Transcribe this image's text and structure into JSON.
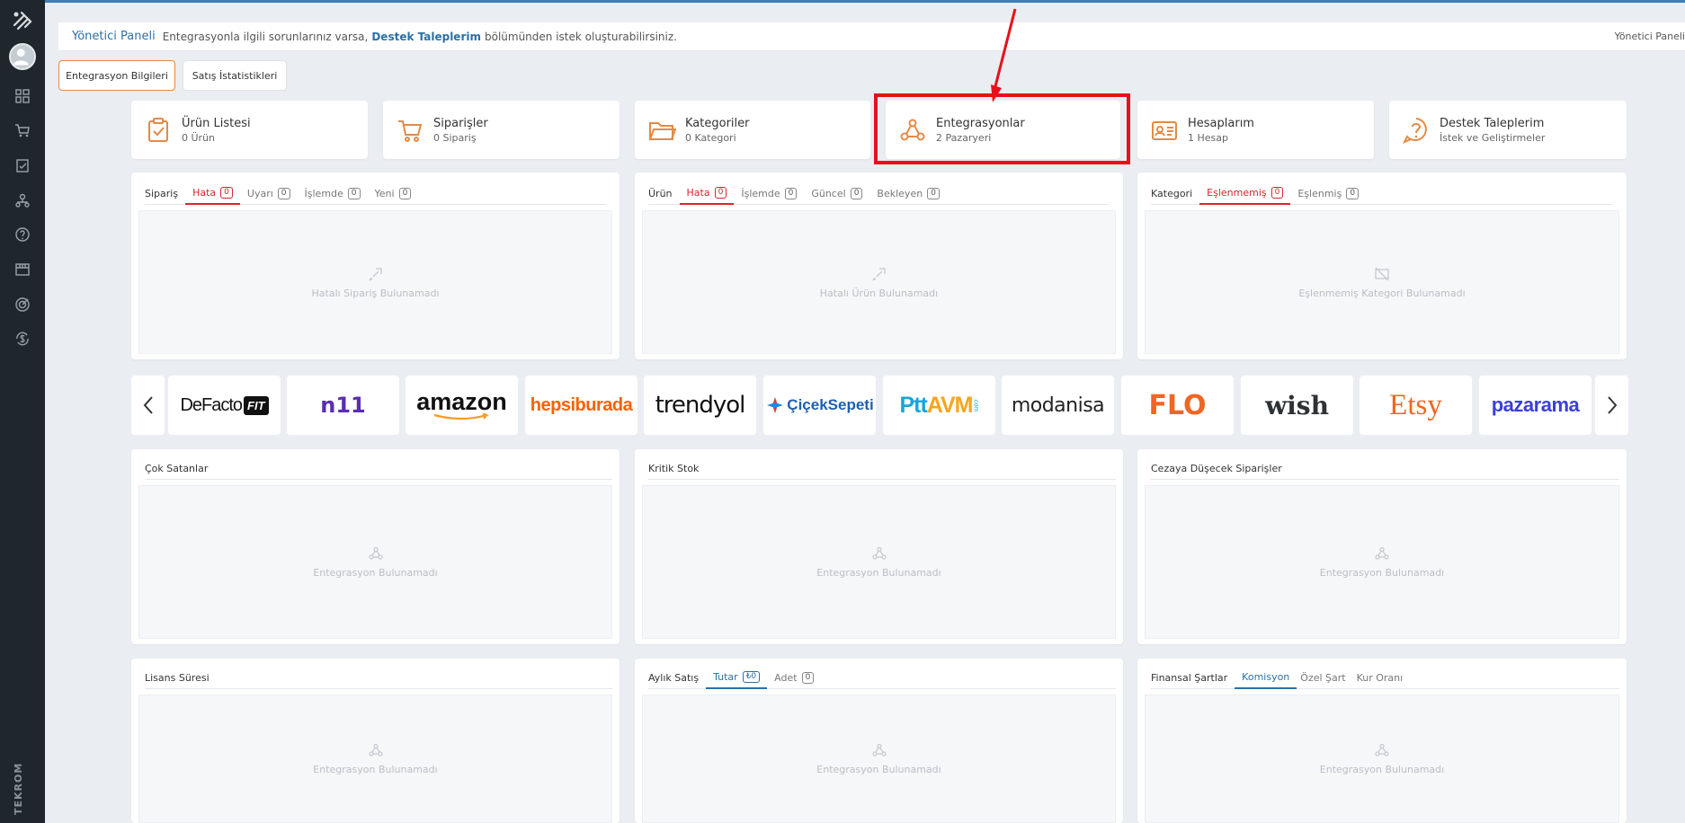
{
  "header": {
    "title": "Yönetici Paneli",
    "message_pre": "Entegrasyonla ilgili sorunlarınız varsa,",
    "message_link": "Destek Taleplerim",
    "message_post": "bölümünden istek oluşturabilirsiniz.",
    "right_text": "Yönetici Paneli"
  },
  "tabs": [
    {
      "label": "Entegrasyon Bilgileri",
      "active": true
    },
    {
      "label": "Satış İstatistikleri",
      "active": false
    }
  ],
  "tiles": [
    {
      "title": "Ürün Listesi",
      "sub": "0 Ürün"
    },
    {
      "title": "Siparişler",
      "sub": "0 Sipariş"
    },
    {
      "title": "Kategoriler",
      "sub": "0 Kategori"
    },
    {
      "title": "Entegrasyonlar",
      "sub": "2 Pazaryeri"
    },
    {
      "title": "Hesaplarım",
      "sub": "1 Hesap"
    },
    {
      "title": "Destek Taleplerim",
      "sub": "İstek ve Geliştirmeler"
    }
  ],
  "order_panel": {
    "lead": "Sipariş",
    "tabs": [
      {
        "label": "Hata",
        "count": "0"
      },
      {
        "label": "Uyarı",
        "count": "0"
      },
      {
        "label": "İşlemde",
        "count": "0"
      },
      {
        "label": "Yeni",
        "count": "0"
      }
    ],
    "empty": "Hatalı Sipariş Bulunamadı"
  },
  "product_panel": {
    "lead": "Ürün",
    "tabs": [
      {
        "label": "Hata",
        "count": "0"
      },
      {
        "label": "İşlemde",
        "count": "0"
      },
      {
        "label": "Güncel",
        "count": "0"
      },
      {
        "label": "Bekleyen",
        "count": "0"
      }
    ],
    "empty": "Hatalı Ürün Bulunamadı"
  },
  "category_panel": {
    "lead": "Kategori",
    "tabs": [
      {
        "label": "Eşlenmemiş",
        "count": "0"
      },
      {
        "label": "Eşlenmiş",
        "count": "0"
      }
    ],
    "empty": "Eşlenmemiş Kategori Bulunamadı"
  },
  "marketplaces": [
    "DeFacto",
    "FIT",
    "n11",
    "amazon",
    "hepsiburada",
    "trendyol",
    "ÇiçekSepeti",
    "Ptt",
    "AVM",
    ".com",
    "modanisa",
    "FLO",
    "wish",
    "Etsy",
    "pazarama"
  ],
  "lower_panels": {
    "best_sellers": {
      "title": "Çok Satanlar",
      "empty": "Entegrasyon Bulunamadı"
    },
    "critical_stock": {
      "title": "Kritik Stok",
      "empty": "Entegrasyon Bulunamadı"
    },
    "penalty_orders": {
      "title": "Cezaya Düşecek Siparişler",
      "empty": "Entegrasyon Bulunamadı"
    },
    "license": {
      "title": "Lisans Süresi",
      "empty": "Entegrasyon Bulunamadı"
    },
    "monthly_sales": {
      "title": "Aylık Satış",
      "tab_amount": "Tutar",
      "tab_amount_count": "₺0",
      "tab_qty": "Adet",
      "tab_qty_count": "0",
      "empty": "Entegrasyon Bulunamadı"
    },
    "financial": {
      "title": "Finansal Şartlar",
      "tab_commission": "Komisyon",
      "tab_special": "Özel Şart",
      "tab_rate": "Kur Oranı",
      "empty": "Entegrasyon Bulunamadı"
    }
  },
  "sidebar": {
    "brand": "TEKROM",
    "icons": [
      "dashboard-icon",
      "cart-icon",
      "clipboard-check-icon",
      "network-icon",
      "help-icon",
      "store-icon",
      "target-icon",
      "money-sync-icon"
    ]
  },
  "colors": {
    "accent_orange": "#e58a45",
    "link_blue": "#2d6fa5",
    "error_red": "#d6262c",
    "sidebar_bg": "#1f272c",
    "highlight_red": "#e8101a"
  }
}
